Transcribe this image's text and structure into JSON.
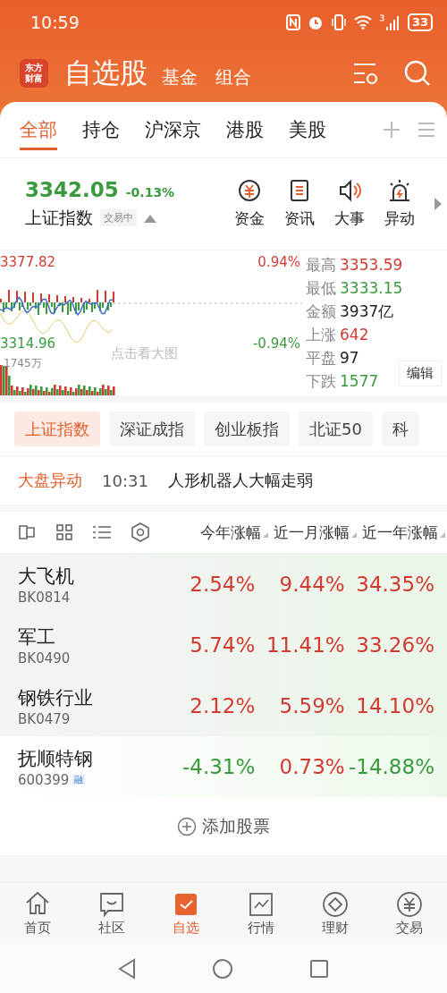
{
  "status_bar": {
    "time": "10:59",
    "battery": "33"
  },
  "header": {
    "logo": [
      "东方",
      "财富"
    ],
    "title": "自选股",
    "links": [
      "基金",
      "组合"
    ]
  },
  "tabs": [
    {
      "label": "全部",
      "selected": true
    },
    {
      "label": "持仓",
      "selected": false
    },
    {
      "label": "沪深京",
      "selected": false
    },
    {
      "label": "港股",
      "selected": false
    },
    {
      "label": "美股",
      "selected": false
    }
  ],
  "index": {
    "value": "3342.05",
    "change": "-0.13%",
    "name": "上证指数",
    "status": "交易中",
    "shortcuts": [
      {
        "kind": "fund",
        "label": "资金"
      },
      {
        "kind": "news",
        "label": "资讯"
      },
      {
        "kind": "event",
        "label": "大事"
      },
      {
        "kind": "alert",
        "label": "异动"
      }
    ]
  },
  "chart": {
    "high_price": "3377.82",
    "high_pct": "0.94%",
    "low_price": "3314.96",
    "low_pct": "-0.94%",
    "volume": "1745万",
    "hint": "点击看大图",
    "edit": "编辑",
    "stats": [
      {
        "label": "最高",
        "value": "3353.59",
        "color": "#d33b32"
      },
      {
        "label": "最低",
        "value": "3333.15",
        "color": "#3a9a3e"
      },
      {
        "label": "金额",
        "value": "3937亿",
        "color": "#222222"
      },
      {
        "label": "上涨",
        "value": "642",
        "color": "#d33b32"
      },
      {
        "label": "平盘",
        "value": "97",
        "color": "#222222"
      },
      {
        "label": "下跌",
        "value": "1577",
        "color": "#3a9a3e"
      }
    ]
  },
  "index_chips": [
    {
      "label": "上证指数",
      "selected": true
    },
    {
      "label": "深证成指",
      "selected": false
    },
    {
      "label": "创业板指",
      "selected": false
    },
    {
      "label": "北证50",
      "selected": false
    },
    {
      "label": "科",
      "selected": false
    }
  ],
  "alert": {
    "label": "大盘异动",
    "time": "10:31",
    "text": "人形机器人大幅走弱"
  },
  "table": {
    "columns": [
      "今年涨幅",
      "近一月涨幅",
      "近一年涨幅"
    ],
    "rows": [
      {
        "name": "大飞机",
        "code": "BK0814",
        "values": [
          {
            "text": "2.54%",
            "color": "#d33b32"
          },
          {
            "text": "9.44%",
            "color": "#d33b32"
          },
          {
            "text": "34.35%",
            "color": "#d33b32"
          }
        ]
      },
      {
        "name": "军工",
        "code": "BK0490",
        "values": [
          {
            "text": "5.74%",
            "color": "#d33b32"
          },
          {
            "text": "11.41%",
            "color": "#d33b32"
          },
          {
            "text": "33.26%",
            "color": "#d33b32"
          }
        ]
      },
      {
        "name": "钢铁行业",
        "code": "BK0479",
        "values": [
          {
            "text": "2.12%",
            "color": "#d33b32"
          },
          {
            "text": "5.59%",
            "color": "#d33b32"
          },
          {
            "text": "14.10%",
            "color": "#d33b32"
          }
        ]
      },
      {
        "name": "抚顺特钢",
        "code": "600399",
        "badge": "融",
        "values": [
          {
            "text": "-4.31%",
            "color": "#3a9a3e"
          },
          {
            "text": "0.73%",
            "color": "#d33b32"
          },
          {
            "text": "-14.88%",
            "color": "#3a9a3e"
          }
        ]
      }
    ]
  },
  "add_stock": "添加股票",
  "bottom_nav": [
    {
      "kind": "home",
      "label": "首页",
      "selected": false
    },
    {
      "kind": "community",
      "label": "社区",
      "selected": false
    },
    {
      "kind": "watchlist",
      "label": "自选",
      "selected": true
    },
    {
      "kind": "market",
      "label": "行情",
      "selected": false
    },
    {
      "kind": "wealth",
      "label": "理财",
      "selected": false
    },
    {
      "kind": "trade",
      "label": "交易",
      "selected": false
    }
  ]
}
